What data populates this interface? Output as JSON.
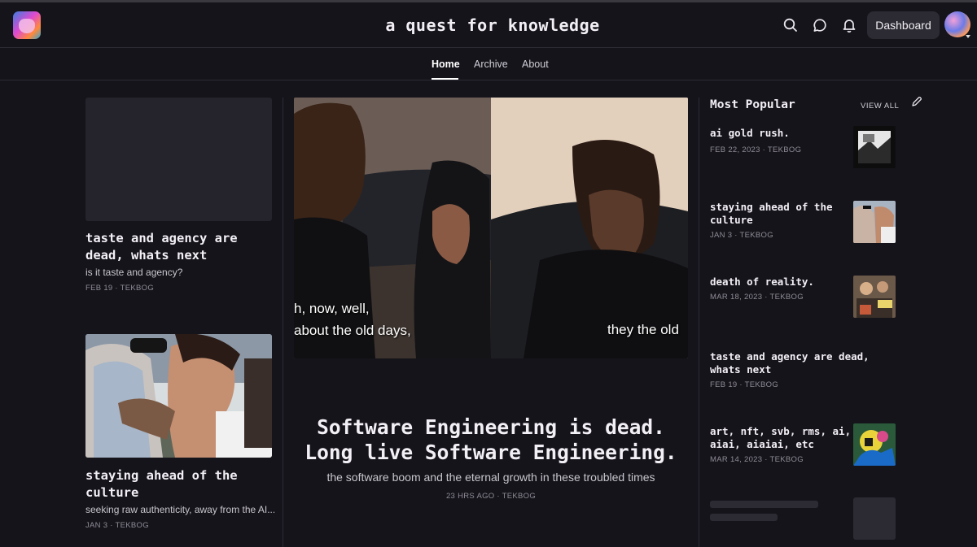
{
  "header": {
    "site_title": "a quest for knowledge",
    "dashboard_label": "Dashboard"
  },
  "nav": {
    "items": [
      "Home",
      "Archive",
      "About"
    ],
    "active": "Home"
  },
  "left_column": {
    "posts": [
      {
        "title": "taste and agency are dead, whats next",
        "subtitle": "is it taste and agency?",
        "meta": "FEB 19 · TEKBOG"
      },
      {
        "title": "staying ahead of the culture",
        "subtitle": "seeking raw authenticity, away from the AI...",
        "meta": "JAN 3 · TEKBOG"
      }
    ]
  },
  "featured": {
    "caption_left_1": "h, now, well,",
    "caption_left_2": "about the old days,",
    "caption_right": "they the old",
    "title_line1": "Software Engineering is dead.",
    "title_line2": "Long live Software Engineering.",
    "subtitle": "the software boom and the eternal growth in these troubled times",
    "meta": "23 HRS AGO · TEKBOG"
  },
  "most_popular": {
    "heading": "Most Popular",
    "view_all": "VIEW ALL",
    "items": [
      {
        "title": "ai gold rush.",
        "meta": "FEB 22, 2023 · TEKBOG"
      },
      {
        "title": "staying ahead of the culture",
        "meta": "JAN 3 · TEKBOG"
      },
      {
        "title": "death of reality.",
        "meta": "MAR 18, 2023 · TEKBOG"
      },
      {
        "title": "taste and agency are dead, whats next",
        "meta": "FEB 19 · TEKBOG"
      },
      {
        "title": "art, nft, svb, rms, ai, aiai, aiaiai, etc",
        "meta": "MAR 14, 2023 · TEKBOG"
      }
    ]
  },
  "colors": {
    "background": "#16141b",
    "button": "#2c2a32",
    "text": "#f2f0f5",
    "muted": "#8e8b95"
  },
  "icons": [
    "search-icon",
    "chat-icon",
    "bell-icon",
    "pencil-icon"
  ]
}
